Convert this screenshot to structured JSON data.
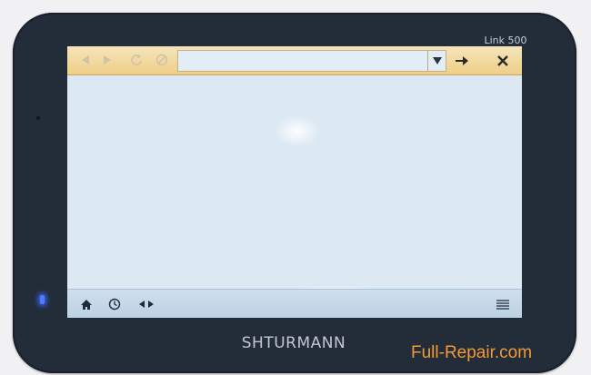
{
  "device": {
    "model": "Link 500",
    "brand": "SHTURMANN"
  },
  "watermark": "Full-Repair.com",
  "browser": {
    "toolbar": {
      "back_icon": "back-arrow-icon",
      "forward_icon": "forward-arrow-icon",
      "reload_icon": "reload-icon",
      "stop_icon": "stop-icon",
      "address_value": "",
      "dropdown_icon": "dropdown-triangle-icon",
      "go_icon": "go-arrow-icon",
      "close_icon": "close-x-icon"
    },
    "bottombar": {
      "home_icon": "home-icon",
      "history_icon": "clock-icon",
      "nav_icon": "left-right-arrows-icon",
      "menu_icon": "menu-lines-icon"
    }
  },
  "colors": {
    "toolbar": "#efcf87",
    "screen": "#dce9f3",
    "bezel": "#232c39",
    "watermark": "#f39a36",
    "led": "#4d7bff"
  }
}
